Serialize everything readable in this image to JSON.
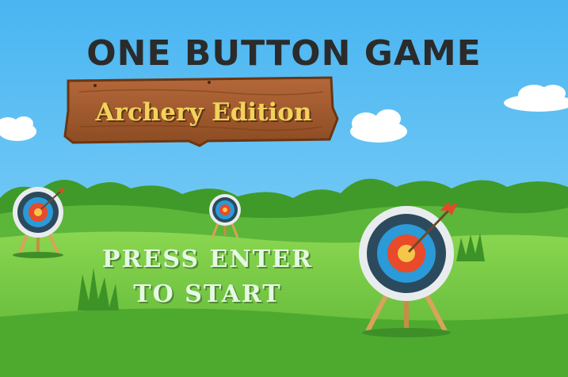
{
  "title": "ONE BUTTON GAME",
  "subtitle": "Archery Edition",
  "prompt_line1": "PRESS ENTER",
  "prompt_line2": "TO START",
  "colors": {
    "sky": "#5fc0f4",
    "grass": "#6ac442",
    "wood": "#a0572a",
    "title": "#2b2b2b",
    "subtitle": "#f2d25a",
    "target_blue": "#2a9ad8",
    "target_red": "#e84a2a",
    "target_yellow": "#f5c64a",
    "arrow_red": "#e04a2a"
  },
  "icons": [
    "cloud-icon",
    "archery-target-icon",
    "arrow-icon",
    "wooden-sign-icon"
  ]
}
